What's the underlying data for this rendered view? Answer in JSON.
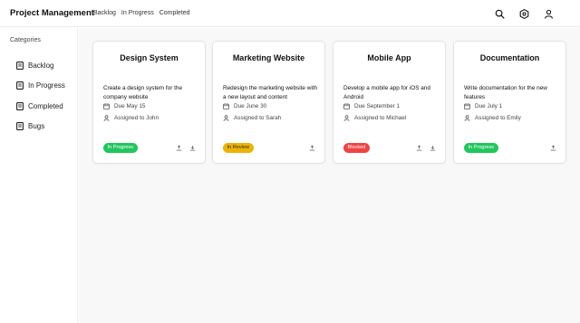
{
  "header": {
    "title": "Project Management",
    "nav": [
      "Backlog",
      "In Progress",
      "Completed"
    ],
    "icons": [
      "search-icon",
      "gear-icon",
      "user-icon"
    ]
  },
  "sidebar": {
    "title": "Categories",
    "items": [
      {
        "label": "Backlog",
        "icon": "board-icon"
      },
      {
        "label": "In Progress",
        "icon": "board-icon"
      },
      {
        "label": "Completed",
        "icon": "board-icon"
      },
      {
        "label": "Bugs",
        "icon": "board-icon"
      }
    ]
  },
  "cards": [
    {
      "title": "Design System",
      "description": "Create a design system for the company website",
      "due": "Due May 15",
      "assigned": "Assigned to John",
      "status": "In Progress",
      "status_color": "#22c55e",
      "action_icons": [
        "upload-icon",
        "download-icon"
      ]
    },
    {
      "title": "Marketing Website",
      "description": "Redesign the marketing website with a new layout and content",
      "due": "Due June 30",
      "assigned": "Assigned to Sarah",
      "status": "In Review",
      "status_color": "#eab308",
      "action_icons": [
        "upload-icon"
      ]
    },
    {
      "title": "Mobile App",
      "description": "Develop a mobile app for iOS and Android",
      "due": "Due September 1",
      "assigned": "Assigned to Michael",
      "status": "Blocked",
      "status_color": "#ef4444",
      "action_icons": [
        "upload-icon",
        "download-icon"
      ]
    },
    {
      "title": "Documentation",
      "description": "Write documentation for the new features",
      "due": "Due July 1",
      "assigned": "Assigned to Emily",
      "status": "In Progress",
      "status_color": "#22c55e",
      "action_icons": [
        "upload-icon"
      ]
    }
  ]
}
